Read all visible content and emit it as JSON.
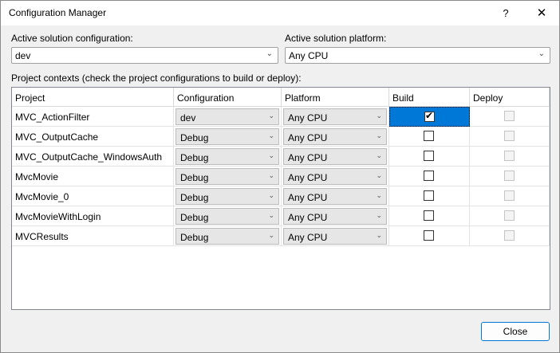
{
  "window": {
    "title": "Configuration Manager",
    "help_glyph": "?",
    "close_glyph": "✕"
  },
  "solution": {
    "config_label": "Active solution configuration:",
    "config_value": "dev",
    "platform_label": "Active solution platform:",
    "platform_value": "Any CPU"
  },
  "contexts_label": "Project contexts (check the project configurations to build or deploy):",
  "grid": {
    "headers": [
      "Project",
      "Configuration",
      "Platform",
      "Build",
      "Deploy"
    ],
    "rows": [
      {
        "project": "MVC_ActionFilter",
        "configuration": "dev",
        "platform": "Any CPU",
        "build": true,
        "deploy": false
      },
      {
        "project": "MVC_OutputCache",
        "configuration": "Debug",
        "platform": "Any CPU",
        "build": false,
        "deploy": false
      },
      {
        "project": "MVC_OutputCache_WindowsAuth",
        "configuration": "Debug",
        "platform": "Any CPU",
        "build": false,
        "deploy": false
      },
      {
        "project": "MvcMovie",
        "configuration": "Debug",
        "platform": "Any CPU",
        "build": false,
        "deploy": false
      },
      {
        "project": "MvcMovie_0",
        "configuration": "Debug",
        "platform": "Any CPU",
        "build": false,
        "deploy": false
      },
      {
        "project": "MvcMovieWithLogin",
        "configuration": "Debug",
        "platform": "Any CPU",
        "build": false,
        "deploy": false
      },
      {
        "project": "MVCResults",
        "configuration": "Debug",
        "platform": "Any CPU",
        "build": false,
        "deploy": false
      }
    ]
  },
  "buttons": {
    "close": "Close"
  },
  "colors": {
    "selection": "#0078d7",
    "accent_border": "#0078d7"
  }
}
